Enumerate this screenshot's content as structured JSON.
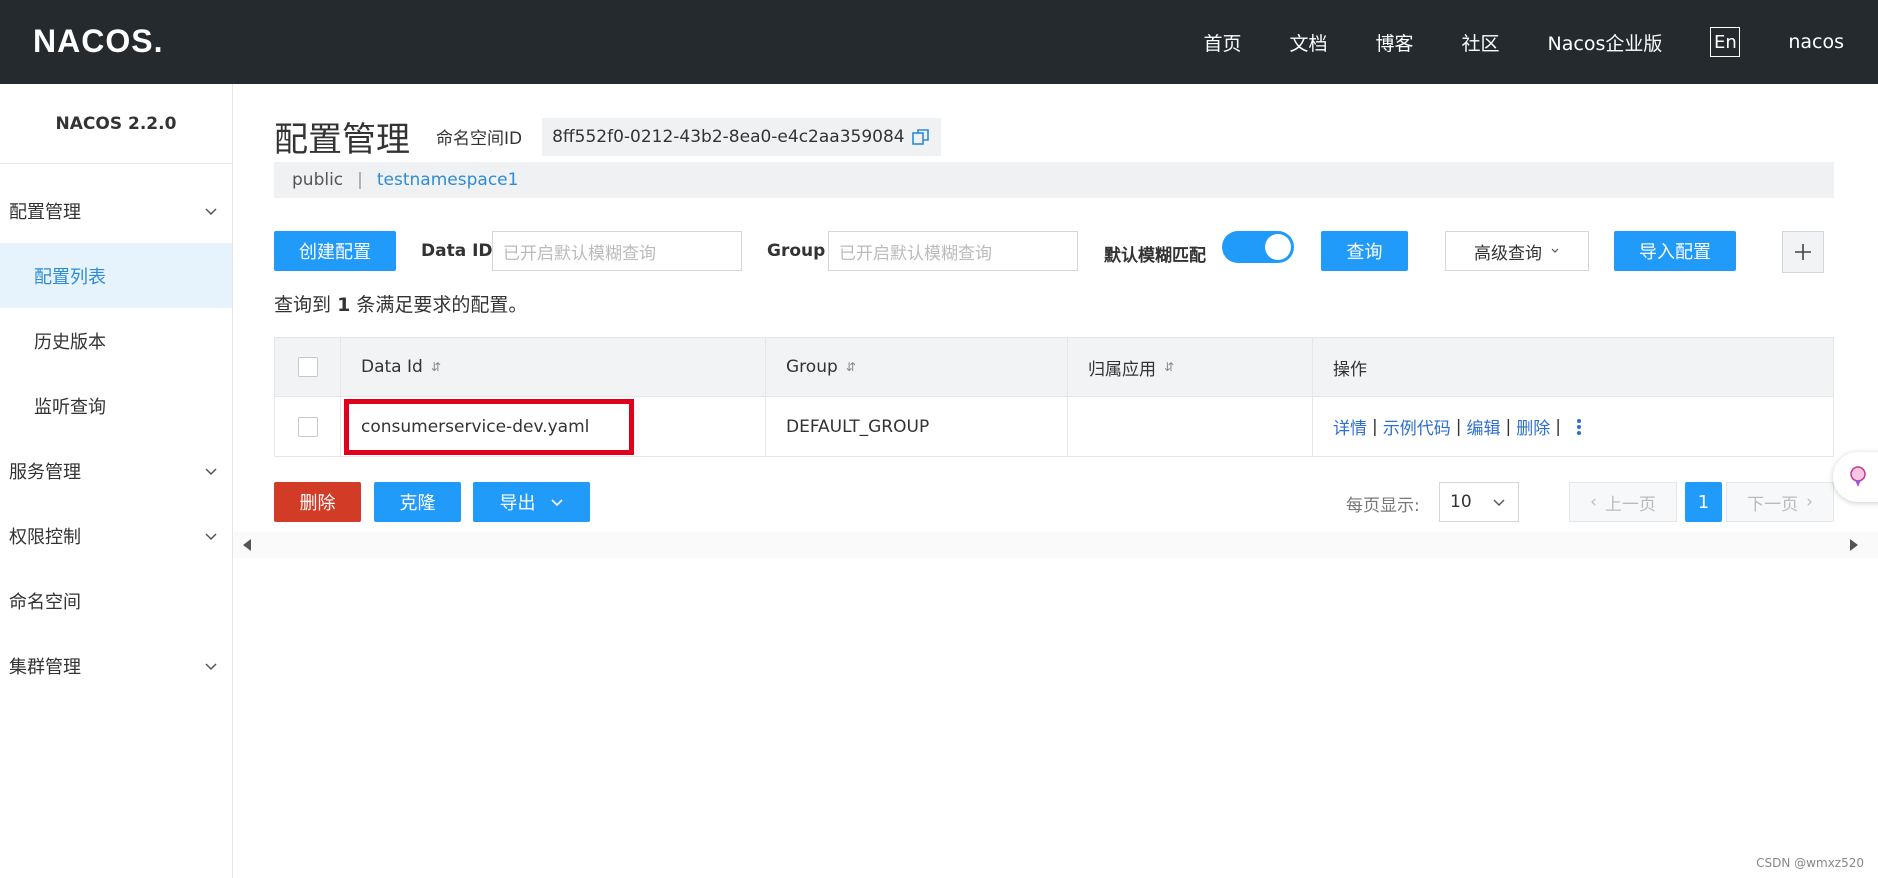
{
  "header": {
    "logo_text": "NACOS.",
    "nav": [
      "首页",
      "文档",
      "博客",
      "社区",
      "Nacos企业版"
    ],
    "lang": "En",
    "user": "nacos"
  },
  "sidebar": {
    "version": "NACOS 2.2.0",
    "items": [
      {
        "label": "配置管理"
      },
      {
        "label": "配置列表"
      },
      {
        "label": "历史版本"
      },
      {
        "label": "监听查询"
      },
      {
        "label": "服务管理"
      },
      {
        "label": "权限控制"
      },
      {
        "label": "命名空间"
      },
      {
        "label": "集群管理"
      }
    ]
  },
  "main": {
    "title": "配置管理",
    "namespace_label": "命名空间ID",
    "namespace_id": "8ff552f0-0212-43b2-8ea0-e4c2aa359084",
    "namespaces": [
      "public",
      "testnamespace1"
    ],
    "namespace_separator": "|",
    "toolbar": {
      "create_label": "创建配置",
      "dataid_label": "Data ID",
      "dataid_placeholder": "已开启默认模糊查询",
      "group_label": "Group",
      "group_placeholder": "已开启默认模糊查询",
      "fuzzy_label": "默认模糊匹配",
      "query_label": "查询",
      "advanced_label": "高级查询",
      "import_label": "导入配置"
    },
    "result": {
      "prefix": "查询到",
      "count": "1",
      "suffix": "条满足要求的配置。"
    },
    "table": {
      "headers": [
        "Data Id",
        "Group",
        "归属应用",
        "操作"
      ],
      "rows": [
        {
          "data_id": "consumerservice-dev.yaml",
          "group": "DEFAULT_GROUP",
          "app": ""
        }
      ],
      "ops": [
        "详情",
        "示例代码",
        "编辑",
        "删除"
      ],
      "op_separator": "|"
    },
    "bottom": {
      "delete_label": "删除",
      "clone_label": "克隆",
      "export_label": "导出",
      "page_size_label": "每页显示:",
      "page_size": "10",
      "prev_label": "上一页",
      "current_page": "1",
      "next_label": "下一页"
    }
  },
  "watermark": "CSDN @wmxz520",
  "colors": {
    "accent": "#209bfa",
    "danger": "#d23c26",
    "header_bg": "#252a2f",
    "highlight": "#e0001b"
  }
}
